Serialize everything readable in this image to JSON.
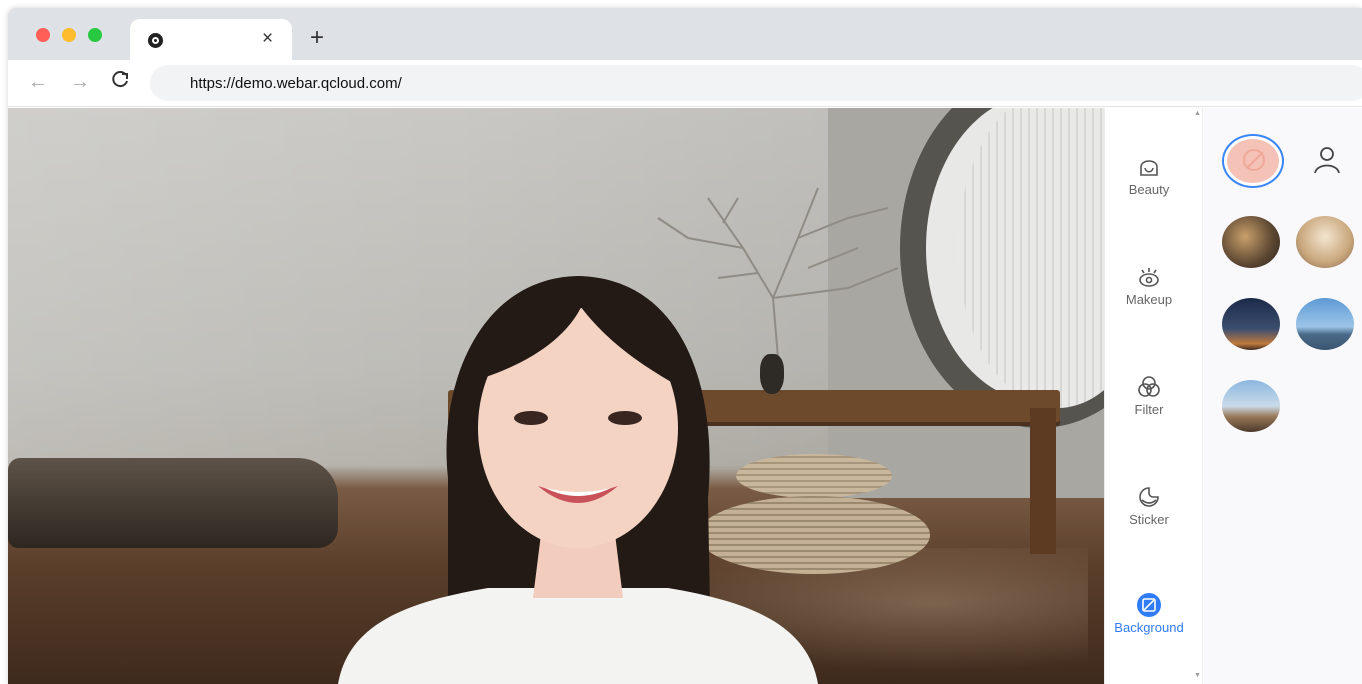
{
  "browser": {
    "tab": {
      "close_label": "×"
    },
    "new_tab_label": "+",
    "nav": {
      "back": "←",
      "forward": "→",
      "reload": "C"
    },
    "url": "https://demo.webar.qcloud.com/"
  },
  "sidebar": {
    "items": [
      {
        "label": "Beauty",
        "icon": "face-outline-icon"
      },
      {
        "label": "Makeup",
        "icon": "eye-icon"
      },
      {
        "label": "Filter",
        "icon": "three-circles-icon"
      },
      {
        "label": "Sticker",
        "icon": "sticker-icon"
      },
      {
        "label": "Background",
        "icon": "background-icon",
        "active": true
      }
    ],
    "accent": "#2f7cf6"
  },
  "panel": {
    "options": [
      {
        "name": "none",
        "selected": true
      },
      {
        "name": "person-only"
      },
      {
        "name": "bg-interior-warm"
      },
      {
        "name": "bg-interior-bright"
      },
      {
        "name": "bg-night-sky"
      },
      {
        "name": "bg-city-skyline"
      },
      {
        "name": "bg-city-sunset"
      }
    ]
  }
}
